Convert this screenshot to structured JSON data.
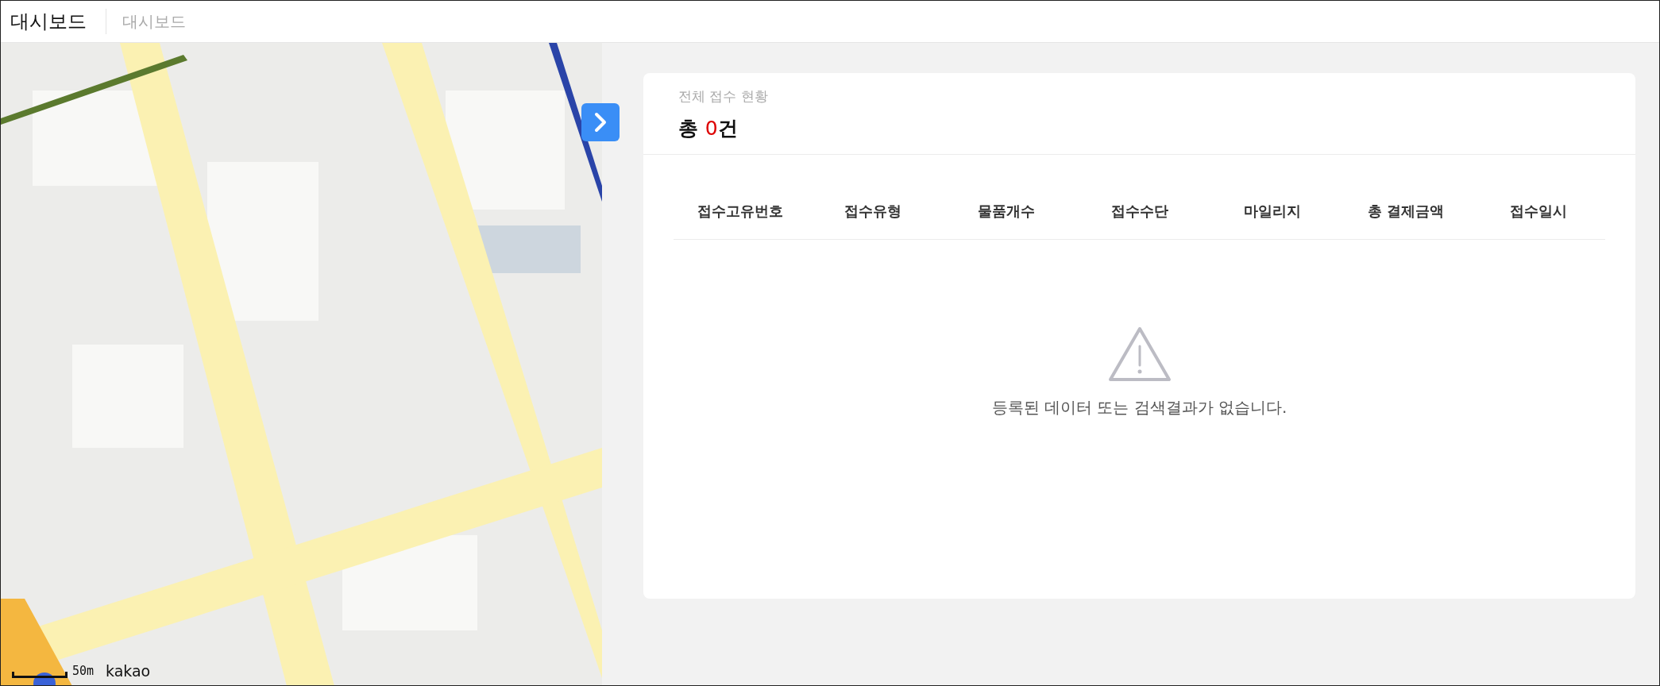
{
  "header": {
    "title": "대시보드",
    "breadcrumb": "대시보드"
  },
  "map": {
    "kind": "picture",
    "scale": "50m",
    "logo": "kakao"
  },
  "panel_toggle": {
    "expanded": false
  },
  "card": {
    "subtitle": "전체 접수 현황",
    "total": {
      "prefix": "총",
      "count": "0",
      "suffix": "건"
    },
    "table": {
      "columns": [
        "접수고유번호",
        "접수유형",
        "물품개수",
        "접수수단",
        "마일리지",
        "총 결제금액",
        "접수일시"
      ]
    },
    "empty_message": "등록된 데이터 또는 검색결과가 없습니다."
  }
}
